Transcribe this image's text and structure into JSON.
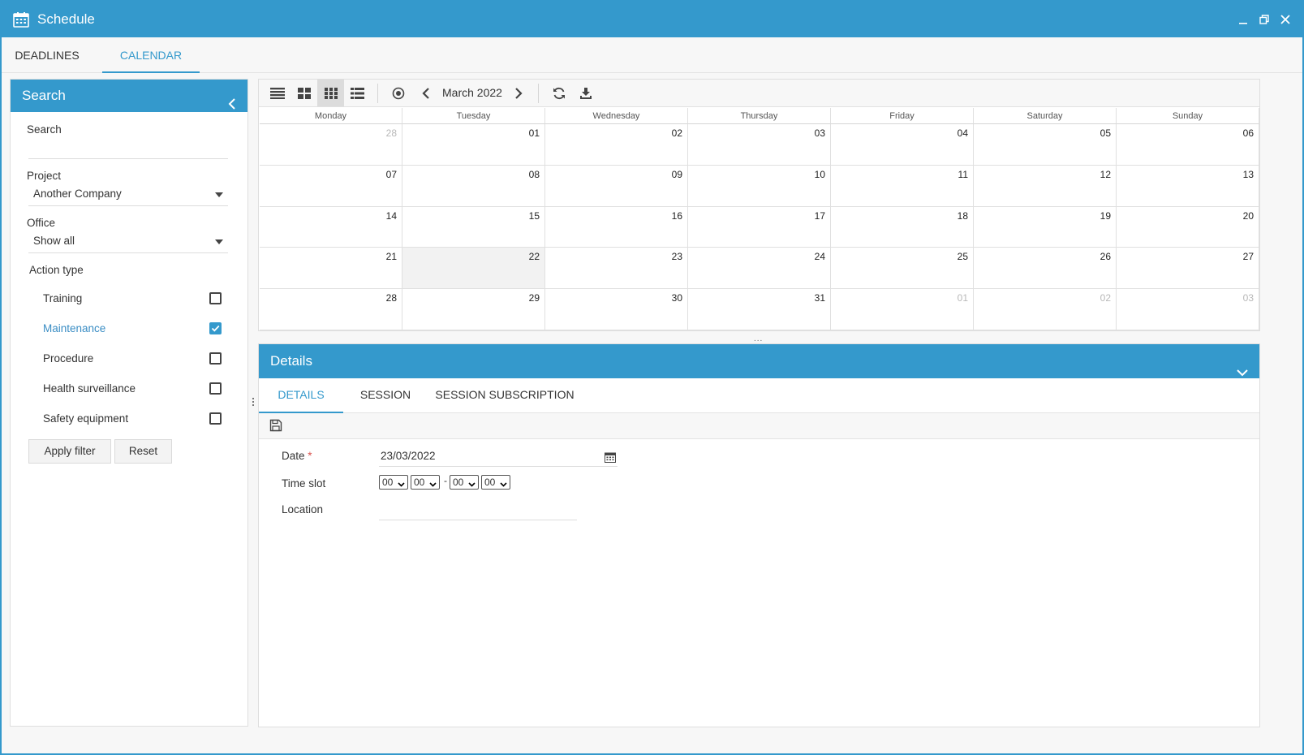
{
  "window": {
    "title": "Schedule"
  },
  "top_tabs": [
    {
      "label": "DEADLINES",
      "active": false
    },
    {
      "label": "CALENDAR",
      "active": true
    }
  ],
  "search_panel": {
    "title": "Search",
    "search_label": "Search",
    "search_value": "",
    "project_label": "Project",
    "project_value": "Another Company",
    "office_label": "Office",
    "office_value": "Show all",
    "action_type_label": "Action type",
    "action_types": [
      {
        "label": "Training",
        "checked": false
      },
      {
        "label": "Maintenance",
        "checked": true
      },
      {
        "label": "Procedure",
        "checked": false
      },
      {
        "label": "Health surveillance",
        "checked": false
      },
      {
        "label": "Safety equipment",
        "checked": false
      }
    ],
    "apply_label": "Apply filter",
    "reset_label": "Reset"
  },
  "calendar": {
    "month_label": "March 2022",
    "weekdays": [
      "Monday",
      "Tuesday",
      "Wednesday",
      "Thursday",
      "Friday",
      "Saturday",
      "Sunday"
    ],
    "weeks": [
      [
        "28",
        "01",
        "02",
        "03",
        "04",
        "05",
        "06"
      ],
      [
        "07",
        "08",
        "09",
        "10",
        "11",
        "12",
        "13"
      ],
      [
        "14",
        "15",
        "16",
        "17",
        "18",
        "19",
        "20"
      ],
      [
        "21",
        "22",
        "23",
        "24",
        "25",
        "26",
        "27"
      ],
      [
        "28",
        "29",
        "30",
        "31",
        "01",
        "02",
        "03"
      ]
    ],
    "other_month_cells": [
      [
        0,
        0
      ],
      [
        4,
        4
      ],
      [
        4,
        5
      ],
      [
        4,
        6
      ]
    ],
    "today_cell": [
      3,
      1
    ]
  },
  "splitter_label": "...",
  "details": {
    "title": "Details",
    "tabs": [
      {
        "label": "DETAILS",
        "active": true
      },
      {
        "label": "SESSION",
        "active": false
      },
      {
        "label": "SESSION SUBSCRIPTION",
        "active": false
      }
    ],
    "date_label": "Date",
    "required_mark": "*",
    "date_value": "23/03/2022",
    "timeslot_label": "Time slot",
    "time_start_hour": "00",
    "time_start_min": "00",
    "time_separator": "-",
    "time_end_hour": "00",
    "time_end_min": "00",
    "location_label": "Location",
    "location_value": ""
  },
  "colors": {
    "accent": "#3499cc",
    "checked_text": "#3a8dc4",
    "required": "#d9534f"
  }
}
